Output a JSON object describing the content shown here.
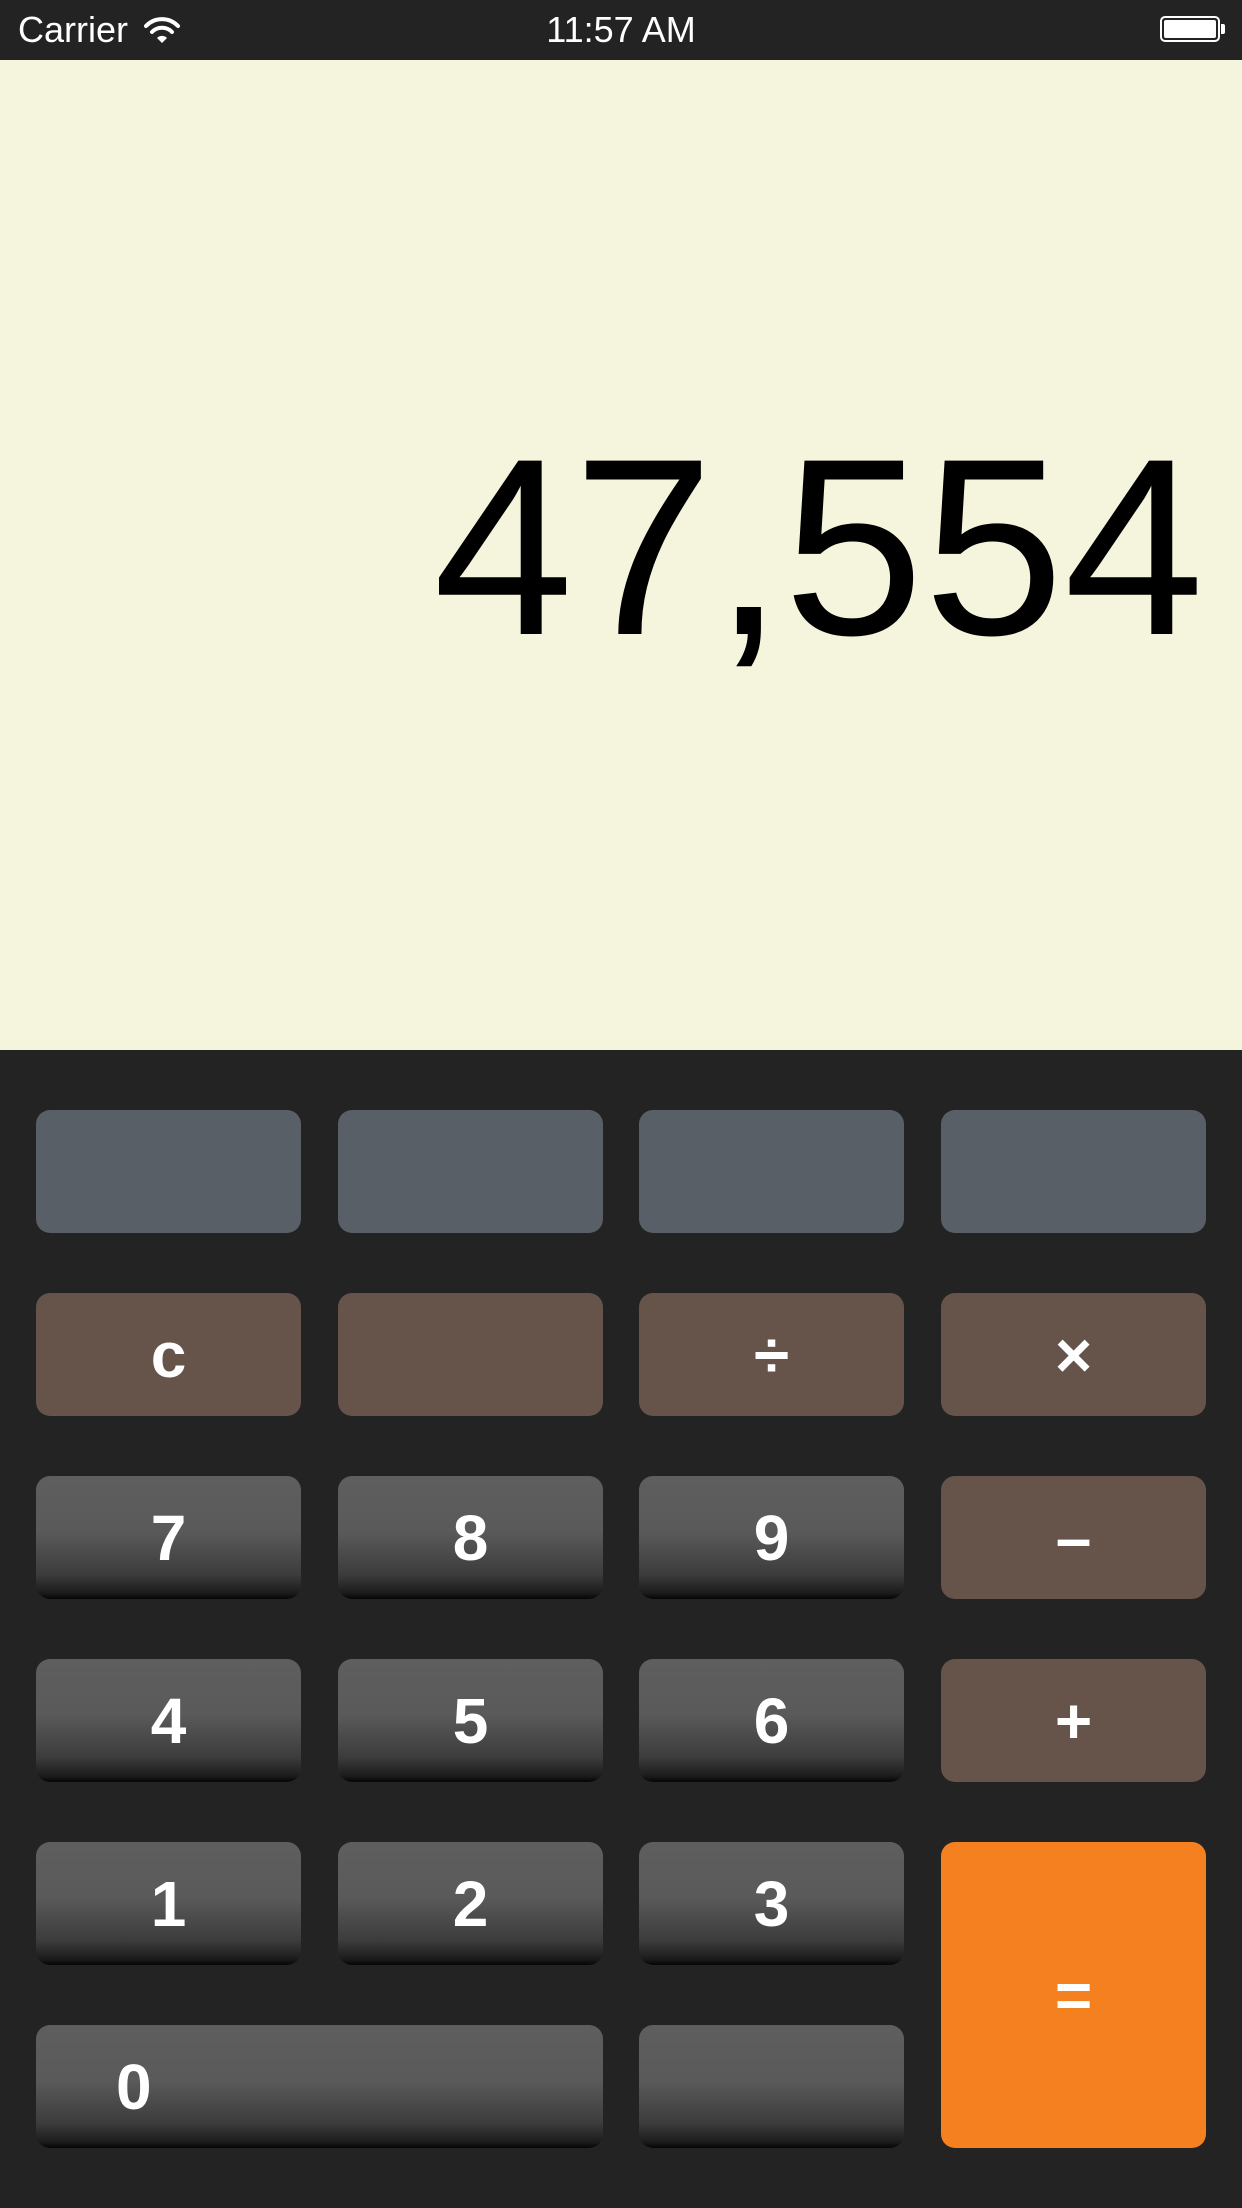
{
  "status_bar": {
    "carrier": "Carrier",
    "time": "11:57 AM",
    "wifi_icon": "wifi-icon",
    "battery_icon": "battery-icon"
  },
  "display": {
    "value": "47,554"
  },
  "keypad": {
    "memory_keys": [
      "",
      "",
      "",
      ""
    ],
    "clear": "c",
    "blank_op": "",
    "divide": "÷",
    "multiply": "×",
    "minus": "–",
    "plus": "+",
    "equals": "=",
    "digits": {
      "d0": "0",
      "d1": "1",
      "d2": "2",
      "d3": "3",
      "d4": "4",
      "d5": "5",
      "d6": "6",
      "d7": "7",
      "d8": "8",
      "d9": "9"
    },
    "blank_num": ""
  },
  "colors": {
    "display_bg": "#f5f4dc",
    "keypad_bg": "#232323",
    "memory_key": "#585f66",
    "operator_key": "#66544a",
    "equals_key": "#f4801f",
    "number_key": "#5a5a5a"
  }
}
